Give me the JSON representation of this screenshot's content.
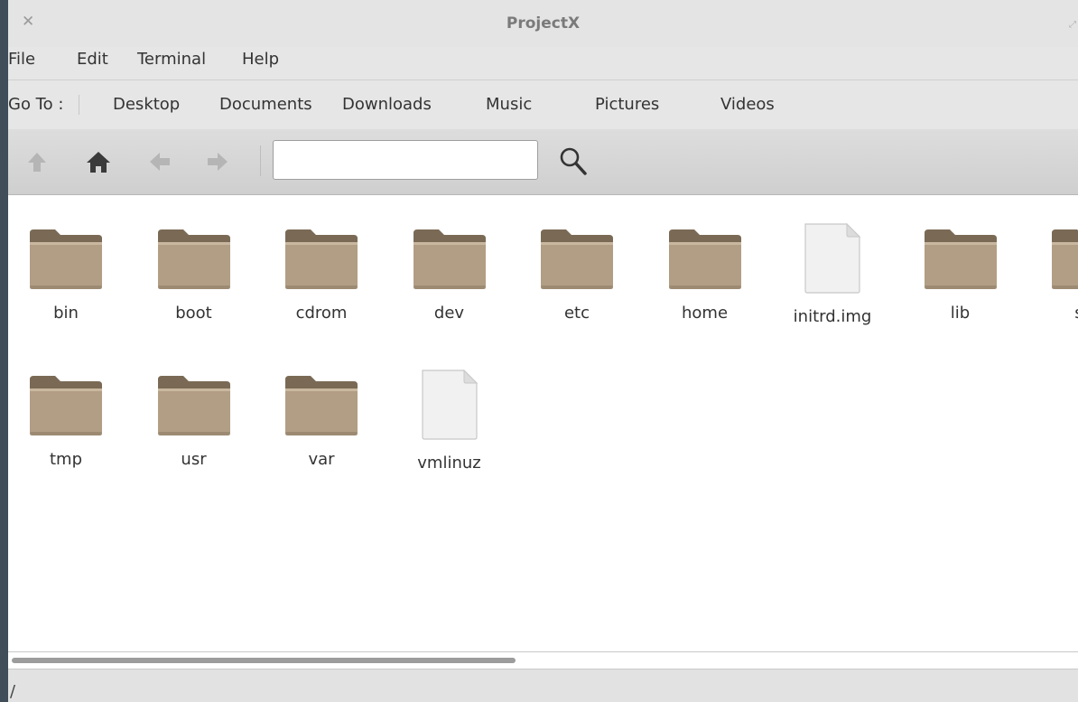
{
  "window": {
    "title": "ProjectX"
  },
  "menubar": {
    "items": [
      "File",
      "Edit",
      "Terminal",
      "Help"
    ]
  },
  "goto": {
    "label": "Go To :",
    "locations": [
      "Desktop",
      "Documents",
      "Downloads",
      "Music",
      "Pictures",
      "Videos"
    ]
  },
  "toolbar": {
    "icons": [
      "up-arrow-icon",
      "home-icon",
      "back-arrow-icon",
      "forward-arrow-icon",
      "search-icon"
    ],
    "path_value": ""
  },
  "files": [
    {
      "name": "bin",
      "type": "folder"
    },
    {
      "name": "boot",
      "type": "folder"
    },
    {
      "name": "cdrom",
      "type": "folder"
    },
    {
      "name": "dev",
      "type": "folder"
    },
    {
      "name": "etc",
      "type": "folder"
    },
    {
      "name": "home",
      "type": "folder"
    },
    {
      "name": "initrd.img",
      "type": "file"
    },
    {
      "name": "lib",
      "type": "folder"
    },
    {
      "name": "sys",
      "type": "folder"
    },
    {
      "name": "tmp",
      "type": "folder"
    },
    {
      "name": "usr",
      "type": "folder"
    },
    {
      "name": "var",
      "type": "folder"
    },
    {
      "name": "vmlinuz",
      "type": "file"
    }
  ],
  "statusbar": {
    "text": "/"
  },
  "colors": {
    "folder": "#b29e85",
    "folder_tab": "#7a6a55",
    "background": "#ffffff",
    "desktop": "#3f4e59"
  }
}
